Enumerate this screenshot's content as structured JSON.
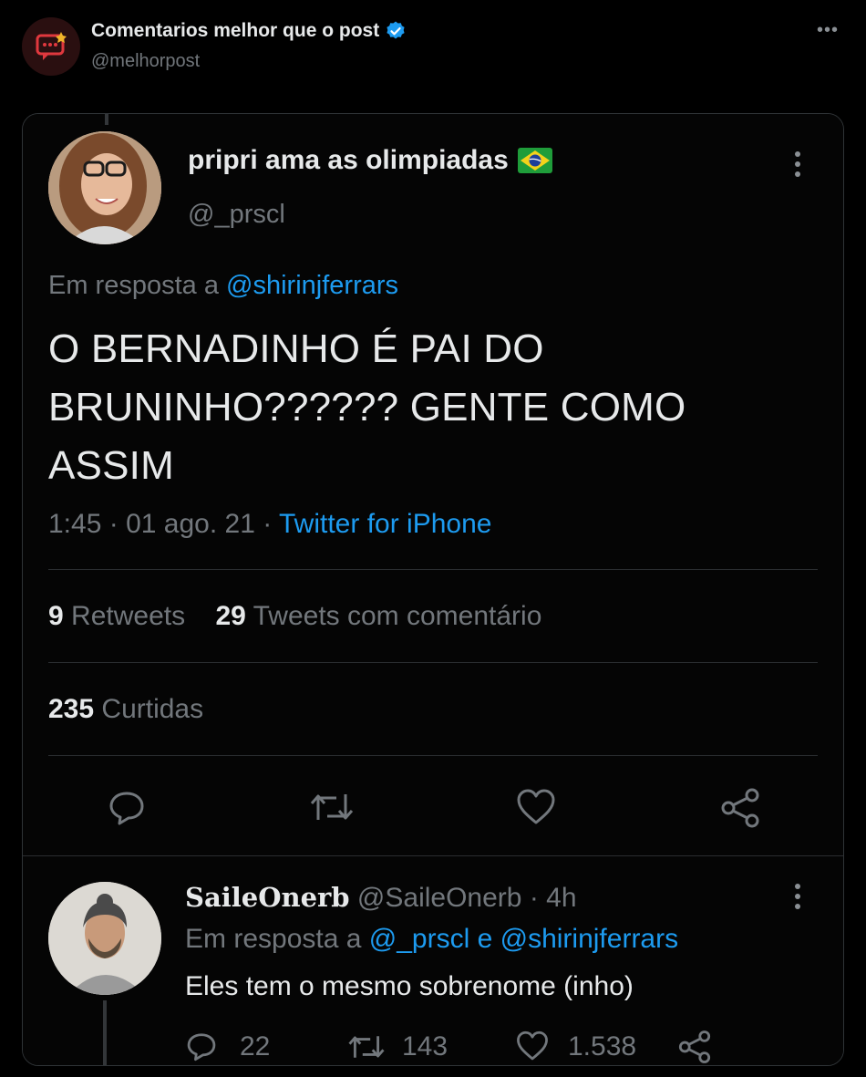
{
  "account": {
    "display_name": "Comentarios melhor que o post",
    "handle": "@melhorpost",
    "avatar_icon": "chat-bubble-icon",
    "verified_color": "#1d9bf0"
  },
  "quoted": {
    "author": {
      "display_name": "pripri ama as olimpiadas",
      "flag": "brazil-flag-icon",
      "handle": "@_prscl"
    },
    "reply_prefix": "Em resposta a",
    "reply_to": "@shirinjferrars",
    "body_lines": [
      "O BERNADINHO É PAI DO",
      "BRUNINHO?????? GENTE COMO",
      "ASSIM"
    ],
    "time": "1:45",
    "date": "01 ago. 21",
    "source": "Twitter for iPhone",
    "separator": "·",
    "stats": {
      "retweets_count": "9",
      "retweets_label": "Retweets",
      "quote_count": "29",
      "quote_label": "Tweets com comentário",
      "likes_count": "235",
      "likes_label": "Curtidas"
    }
  },
  "reply": {
    "display_name": "SaileOnerb",
    "handle": "@SaileOnerb",
    "age": "4h",
    "separator": "·",
    "reply_prefix": "Em resposta a",
    "reply_to_1": "@_prscl",
    "reply_conj": "e",
    "reply_to_2": "@shirinjferrars",
    "body": "Eles tem o mesmo sobrenome (inho)",
    "counts": {
      "replies": "22",
      "retweets": "143",
      "likes": "1.538"
    }
  },
  "colors": {
    "link": "#1d9bf0",
    "muted": "#72777c",
    "text": "#e7e9ea",
    "background": "#000000"
  }
}
